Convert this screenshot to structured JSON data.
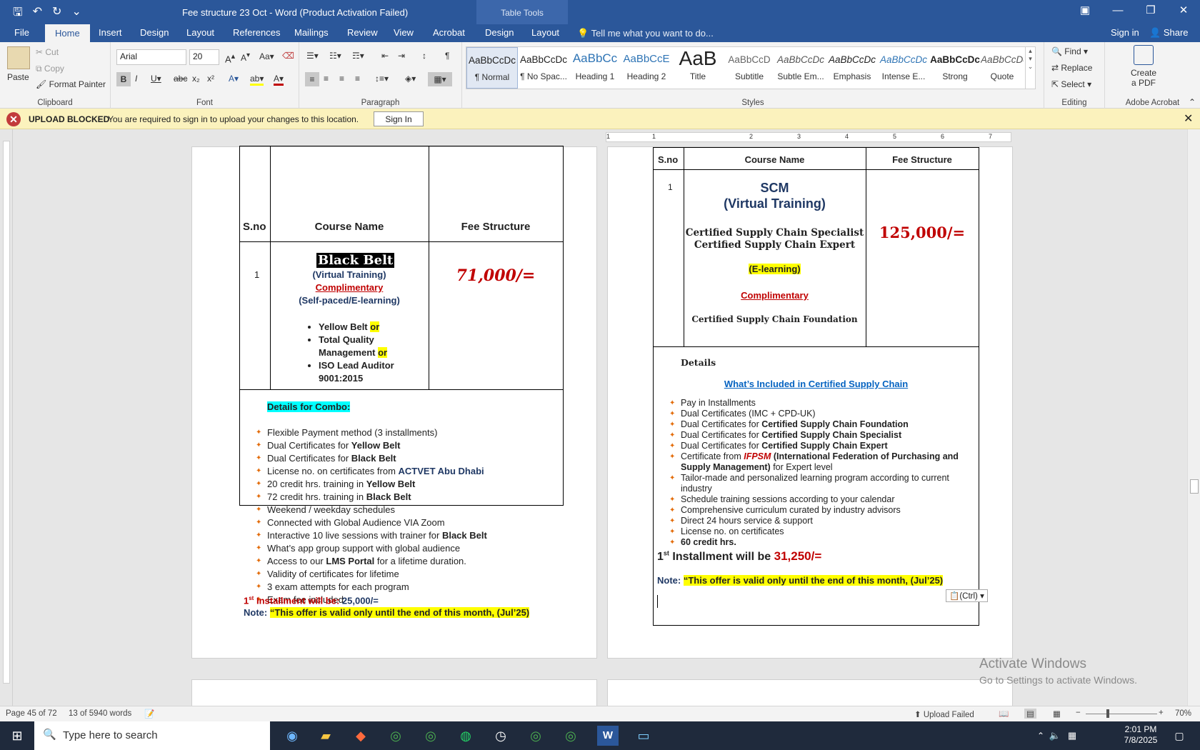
{
  "window": {
    "title": "Fee structure 23 Oct - Word (Product Activation Failed)",
    "table_tools": "Table Tools",
    "controls": [
      "▣",
      "—",
      "❐",
      "✕"
    ]
  },
  "qat": {
    "save": "🖫",
    "undo": "↶",
    "redo": "↻",
    "more": "⌄"
  },
  "tabs": {
    "file": "File",
    "home": "Home",
    "insert": "Insert",
    "design": "Design",
    "layout": "Layout",
    "references": "References",
    "mailings": "Mailings",
    "review": "Review",
    "view": "View",
    "acrobat": "Acrobat",
    "table_design": "Design",
    "table_layout": "Layout",
    "tellme": "Tell me what you want to do...",
    "signin": "Sign in",
    "share": "Share"
  },
  "ribbon": {
    "clipboard": {
      "paste": "Paste",
      "cut": "Cut",
      "copy": "Copy",
      "format_painter": "Format Painter",
      "label": "Clipboard"
    },
    "font": {
      "name": "Arial",
      "size": "20",
      "label": "Font"
    },
    "paragraph": {
      "label": "Paragraph"
    },
    "styles": {
      "label": "Styles",
      "items": [
        {
          "sample": "AaBbCcDc",
          "name": "¶ Normal"
        },
        {
          "sample": "AaBbCcDc",
          "name": "¶ No Spac..."
        },
        {
          "sample": "AaBbCc",
          "name": "Heading 1"
        },
        {
          "sample": "AaBbCcE",
          "name": "Heading 2"
        },
        {
          "sample": "AaB",
          "name": "Title"
        },
        {
          "sample": "AaBbCcD",
          "name": "Subtitle"
        },
        {
          "sample": "AaBbCcDc",
          "name": "Subtle Em..."
        },
        {
          "sample": "AaBbCcDc",
          "name": "Emphasis"
        },
        {
          "sample": "AaBbCcDc",
          "name": "Intense E..."
        },
        {
          "sample": "AaBbCcDc",
          "name": "Strong"
        },
        {
          "sample": "AaBbCcDc",
          "name": "Quote"
        }
      ]
    },
    "editing": {
      "find": "Find",
      "replace": "Replace",
      "select": "Select",
      "label": "Editing"
    },
    "acrobat": {
      "create": "Create",
      "pdf": "a PDF",
      "label": "Adobe Acrobat"
    }
  },
  "notification": {
    "head": "UPLOAD BLOCKED",
    "message": "You are required to sign in to upload your changes to this location.",
    "button": "Sign In"
  },
  "ruler": {
    "ticks": [
      "1",
      "1",
      "2",
      "3",
      "4",
      "5",
      "6",
      "7"
    ]
  },
  "left_page": {
    "headers": {
      "sno": "S.no",
      "course": "Course Name",
      "fee": "Fee Structure"
    },
    "row": {
      "sno": "1",
      "title": "Black Belt",
      "virtual": "(Virtual Training)",
      "complimentary": "Complimentary",
      "selfpaced": "(Self-paced/E-learning)",
      "options": [
        {
          "text": "Yellow Belt ",
          "or": "or"
        },
        {
          "text": "Total Quality",
          "or": ""
        },
        {
          "text": "Management ",
          "or": "or"
        },
        {
          "text": "ISO Lead Auditor",
          "or": ""
        },
        {
          "text": "9001:2015",
          "or": ""
        }
      ],
      "fee": "71,000/="
    },
    "details_title": "Details for Combo:",
    "details": [
      {
        "text": "Flexible Payment method (3 installments)",
        "bold": ""
      },
      {
        "text": " Dual Certificates for ",
        "bold": "Yellow Belt"
      },
      {
        "text": "Dual Certificates for ",
        "bold": "Black Belt"
      },
      {
        "text": "License no. on certificates from ",
        "bold": "ACTVET Abu Dhabi"
      },
      {
        "text": "20 credit hrs. training in ",
        "bold": "Yellow Belt"
      },
      {
        "text": "72 credit hrs. training in ",
        "bold": "Black Belt"
      },
      {
        "text": "Weekend / weekday schedules",
        "bold": ""
      },
      {
        "text": "Connected with Global Audience VIA Zoom",
        "bold": ""
      },
      {
        "text": "Interactive 10 live sessions with trainer for ",
        "bold": "Black Belt"
      },
      {
        "text": "What’s app group support with global audience",
        "bold": ""
      },
      {
        "text": "Access to our ",
        "bold": "LMS Portal",
        "after": " for a lifetime duration."
      },
      {
        "text": "Validity of certificates for lifetime",
        "bold": ""
      },
      {
        "text": "3 exam attempts for each program",
        "bold": ""
      },
      {
        "text": "Exam fee included",
        "bold": ""
      }
    ],
    "installment": {
      "num": "1",
      "sup": "st",
      "label": " Installment will be: ",
      "value": "25,000/="
    },
    "note": {
      "label": "Note: ",
      "text": "“This offer is valid only until the end of this month, (Jul’25)"
    }
  },
  "right_page": {
    "headers": {
      "sno": "S.no",
      "course": "Course Name",
      "fee": "Fee Structure"
    },
    "row": {
      "sno": "1",
      "title": "SCM",
      "virtual": "(Virtual Training)",
      "specialist": "Certified Supply Chain Specialist",
      "expert": "Certified Supply Chain Expert",
      "elearning": "(E-learning)",
      "complimentary": "Complimentary",
      "foundation": "Certified Supply Chain Foundation",
      "fee": "125,000/="
    },
    "details_title": "Details",
    "included_title": "What’s Included in Certified Supply Chain",
    "details": [
      {
        "text": "Pay in Installments",
        "bold": ""
      },
      {
        "text": "Dual Certificates (IMC + CPD-UK)",
        "bold": ""
      },
      {
        "text": "Dual Certificates for ",
        "bold": "Certified Supply Chain Foundation"
      },
      {
        "text": "Dual Certificates for ",
        "bold": "Certified Supply Chain Specialist"
      },
      {
        "text": "Dual Certificates for ",
        "bold": "Certified Supply Chain Expert"
      },
      {
        "text": "Certificate from ",
        "red": "IFPSM",
        "bold": " (International Federation of Purchasing and",
        "line2b": "Supply Management)",
        "line2": " for Expert level"
      },
      {
        "text": "Tailor-made and personalized learning program according to current",
        "line2": "industry"
      },
      {
        "text": "Schedule training sessions according to your calendar",
        "bold": ""
      },
      {
        "text": "Comprehensive curriculum curated by industry advisors",
        "bold": ""
      },
      {
        "text": "Direct 24 hours service & support",
        "bold": ""
      },
      {
        "text": "License no. on certificates",
        "bold": ""
      },
      {
        "text": "",
        "bold": "60 credit hrs."
      }
    ],
    "installment": {
      "num": "1",
      "sup": "st",
      "label": " Installment will be ",
      "value": "31,250/="
    },
    "note": {
      "label": "Note: ",
      "text": "“This offer is valid only until the end of this month, (Jul’25)"
    },
    "paste_options": "(Ctrl)"
  },
  "watermark": {
    "title": "Activate Windows",
    "sub": "Go to Settings to activate Windows."
  },
  "status": {
    "page": "Page 45 of 72",
    "words": "13 of 5940 words",
    "upload": "Upload Failed",
    "zoom": "70%"
  },
  "taskbar": {
    "search": "Type here to search",
    "time": "2:01 PM",
    "date": "7/8/2025"
  },
  "colors": {
    "accent": "#2b579a",
    "red": "#c00000",
    "highlight": "#ffff00",
    "cyan": "#00ffff"
  }
}
